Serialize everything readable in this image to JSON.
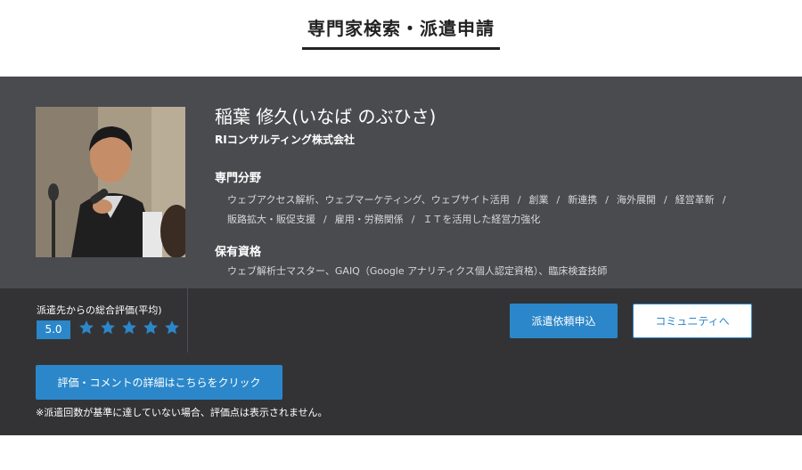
{
  "page_title": "専門家検索・派遣申請",
  "profile": {
    "name": "稲葉 修久(いなば のぶひさ)",
    "company": "RIコンサルティング株式会社",
    "photo_icon": "expert-photo",
    "specialty_heading": "専門分野",
    "specialties": [
      "ウェブアクセス解析、ウェブマーケティング、ウェブサイト活用",
      "創業",
      "新連携",
      "海外展開",
      "経営革新",
      "販路拡大・販促支援",
      "雇用・労務関係",
      "ＩＴを活用した経営力強化"
    ],
    "separator": "/",
    "qualification_heading": "保有資格",
    "qualifications": "ウェブ解析士マスター、GAIQ（Google アナリティクス個人認定資格）、臨床検査技師"
  },
  "rating": {
    "label": "派遣先からの総合評価(平均)",
    "score": "5.0",
    "stars": 5,
    "star_color": "#2b87c9"
  },
  "buttons": {
    "dispatch": "派遣依頼申込",
    "community": "コミュニティへ",
    "detail": "評価・コメントの詳細はこちらをクリック"
  },
  "note": "※派遣回数が基準に達していない場合、評価点は表示されません。",
  "colors": {
    "accent": "#2b87c9",
    "profile_bg": "#4a4b4f",
    "lower_bg": "#333336"
  }
}
